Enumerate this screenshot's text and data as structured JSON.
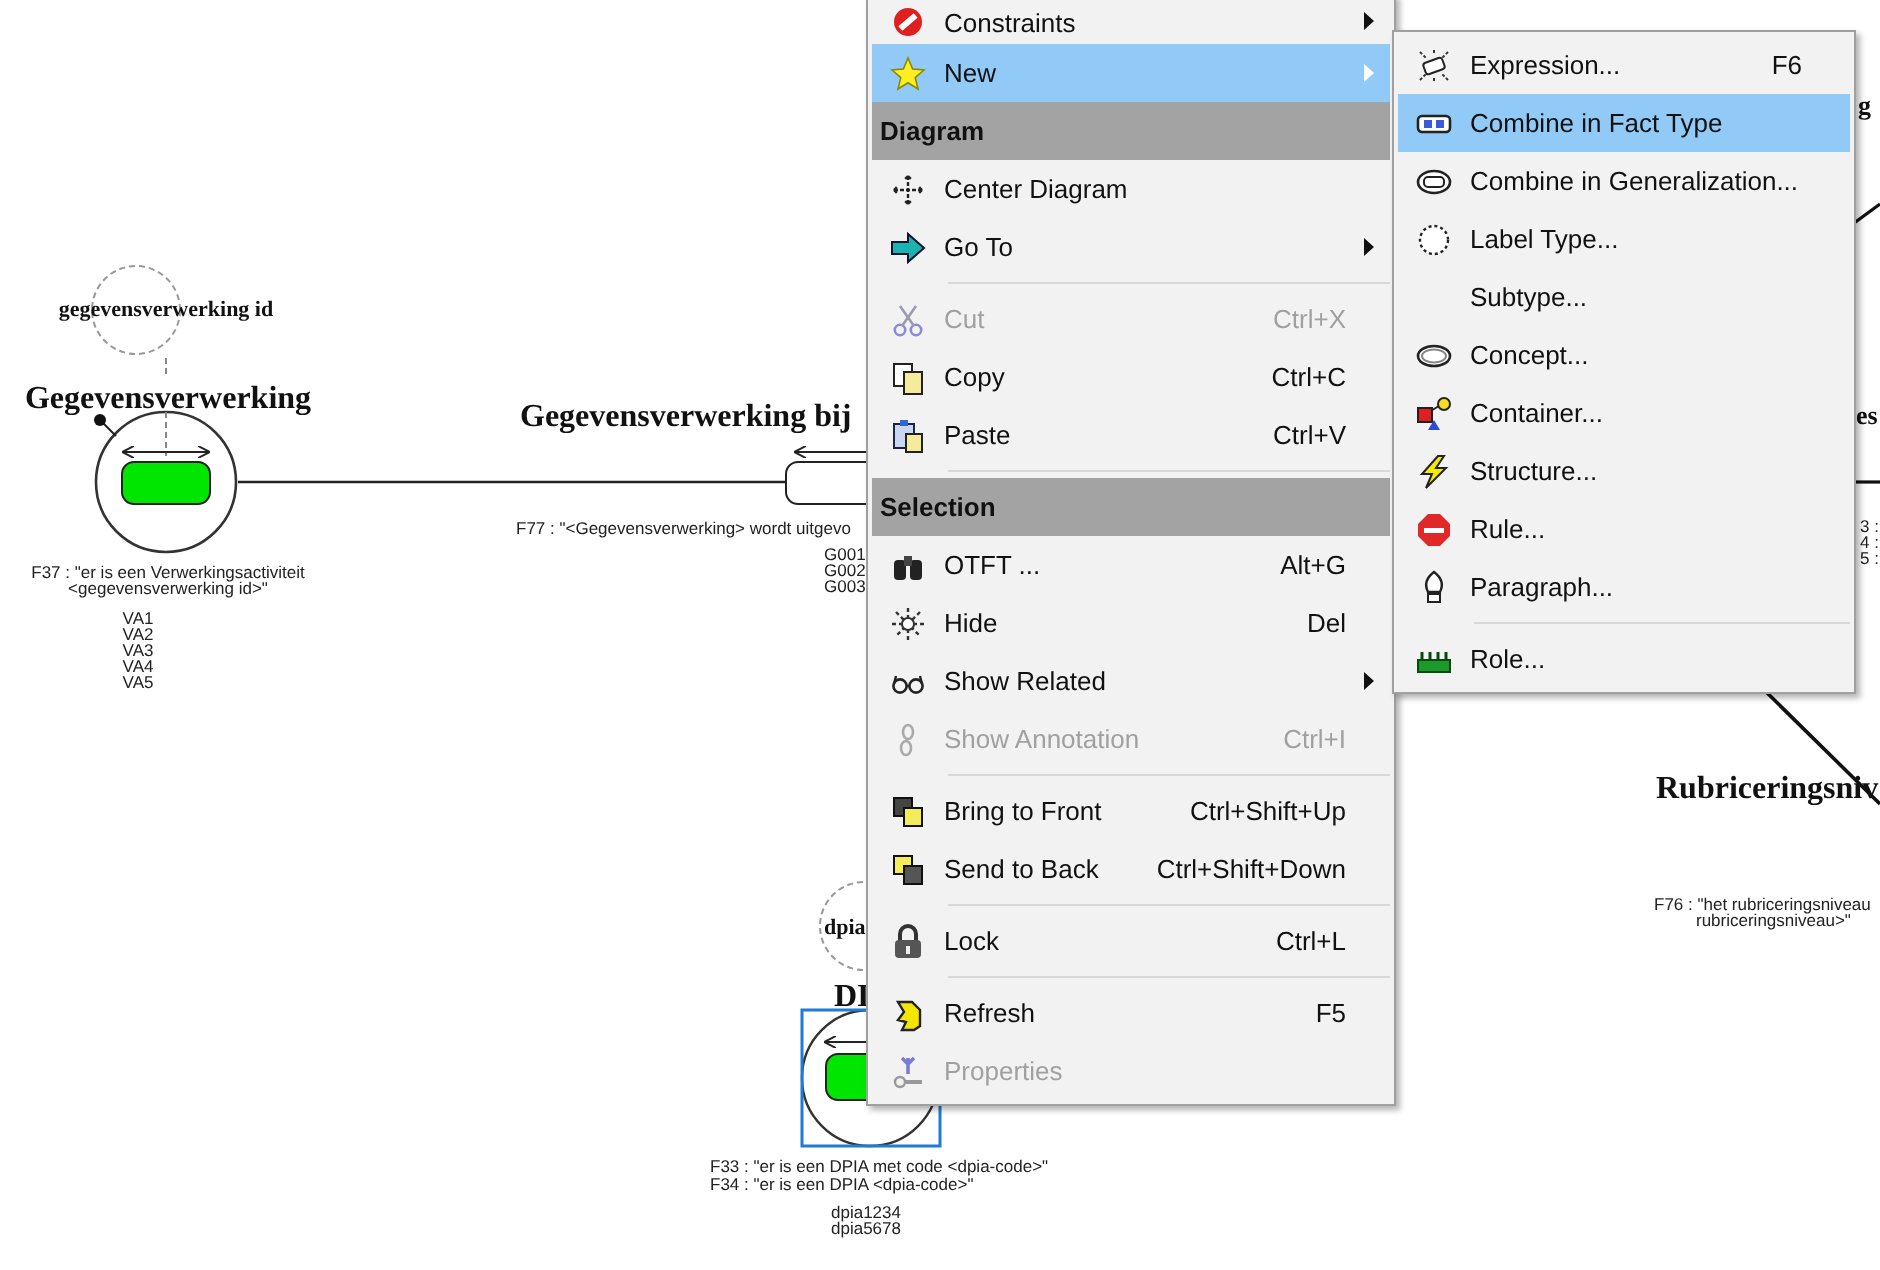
{
  "diagram": {
    "object_types": [
      {
        "role_label": "gegevensverwerking id",
        "name": "Gegevensverwerking",
        "fact_lines": [
          "F37 : \"er is een Verwerkingsactiviteit",
          "<gegevensverwerking id>\""
        ],
        "examples": [
          "VA1",
          "VA2",
          "VA3",
          "VA4",
          "VA5"
        ],
        "selected": false
      },
      {
        "role_label": "dpia",
        "name": "DI",
        "fact_lines": [
          "F33 : \"er is een DPIA met code <dpia-code>\"",
          "F34 : \"er is een DPIA <dpia-code>\""
        ],
        "examples": [
          "dpia1234",
          "dpia5678"
        ],
        "selected": true
      }
    ],
    "fact_type": {
      "name": "Gegevensverwerking bij",
      "fact_lines": [
        "F77 : \"<Gegevensverwerking> wordt uitgevo"
      ],
      "examples": [
        "G001",
        "G002",
        "G003"
      ]
    },
    "partial_type": {
      "name": "Rubriceringsniv",
      "fact_lines": [
        "F76 : \"het rubriceringsniveau",
        "rubriceringsniveau>\""
      ]
    },
    "edge_fragments": [
      "g",
      "es",
      "3 :",
      "4 :",
      "5 :"
    ]
  },
  "menu": {
    "items": [
      {
        "kind": "item",
        "label": "Constraints",
        "submenu": true,
        "disabled": false,
        "selected": false
      },
      {
        "kind": "item",
        "label": "New",
        "submenu": true,
        "disabled": false,
        "selected": true
      },
      {
        "kind": "header",
        "label": "Diagram"
      },
      {
        "kind": "item",
        "label": "Center Diagram",
        "submenu": false,
        "disabled": false,
        "selected": false
      },
      {
        "kind": "item",
        "label": "Go To",
        "submenu": true,
        "disabled": false,
        "selected": false
      },
      {
        "kind": "separator"
      },
      {
        "kind": "item",
        "label": "Cut",
        "shortcut": "Ctrl+X",
        "submenu": false,
        "disabled": true,
        "selected": false
      },
      {
        "kind": "item",
        "label": "Copy",
        "shortcut": "Ctrl+C",
        "submenu": false,
        "disabled": false,
        "selected": false
      },
      {
        "kind": "item",
        "label": "Paste",
        "shortcut": "Ctrl+V",
        "submenu": false,
        "disabled": false,
        "selected": false
      },
      {
        "kind": "separator"
      },
      {
        "kind": "header",
        "label": "Selection"
      },
      {
        "kind": "item",
        "label": "OTFT ...",
        "shortcut": "Alt+G",
        "submenu": false,
        "disabled": false,
        "selected": false
      },
      {
        "kind": "item",
        "label": "Hide",
        "shortcut": "Del",
        "submenu": false,
        "disabled": false,
        "selected": false
      },
      {
        "kind": "item",
        "label": "Show Related",
        "submenu": true,
        "disabled": false,
        "selected": false
      },
      {
        "kind": "item",
        "label": "Show Annotation",
        "shortcut": "Ctrl+I",
        "submenu": false,
        "disabled": true,
        "selected": false
      },
      {
        "kind": "separator"
      },
      {
        "kind": "item",
        "label": "Bring to Front",
        "shortcut": "Ctrl+Shift+Up",
        "submenu": false,
        "disabled": false,
        "selected": false
      },
      {
        "kind": "item",
        "label": "Send to Back",
        "shortcut": "Ctrl+Shift+Down",
        "submenu": false,
        "disabled": false,
        "selected": false
      },
      {
        "kind": "separator"
      },
      {
        "kind": "item",
        "label": "Lock",
        "shortcut": "Ctrl+L",
        "submenu": false,
        "disabled": false,
        "selected": false
      },
      {
        "kind": "separator"
      },
      {
        "kind": "item",
        "label": "Refresh",
        "shortcut": "F5",
        "submenu": false,
        "disabled": false,
        "selected": false
      },
      {
        "kind": "item",
        "label": "Properties",
        "submenu": false,
        "disabled": true,
        "selected": false
      }
    ]
  },
  "submenu": {
    "items": [
      {
        "kind": "item",
        "label": "Expression...",
        "shortcut": "F6",
        "selected": false
      },
      {
        "kind": "item",
        "label": "Combine in Fact Type",
        "selected": true
      },
      {
        "kind": "item",
        "label": "Combine in Generalization...",
        "selected": false
      },
      {
        "kind": "item",
        "label": "Label Type...",
        "selected": false
      },
      {
        "kind": "item",
        "label": "Subtype...",
        "selected": false
      },
      {
        "kind": "item",
        "label": "Concept...",
        "selected": false
      },
      {
        "kind": "item",
        "label": "Container...",
        "selected": false
      },
      {
        "kind": "item",
        "label": "Structure...",
        "selected": false
      },
      {
        "kind": "item",
        "label": "Rule...",
        "selected": false
      },
      {
        "kind": "item",
        "label": "Paragraph...",
        "selected": false
      },
      {
        "kind": "separator"
      },
      {
        "kind": "item",
        "label": "Role...",
        "selected": false
      }
    ]
  }
}
